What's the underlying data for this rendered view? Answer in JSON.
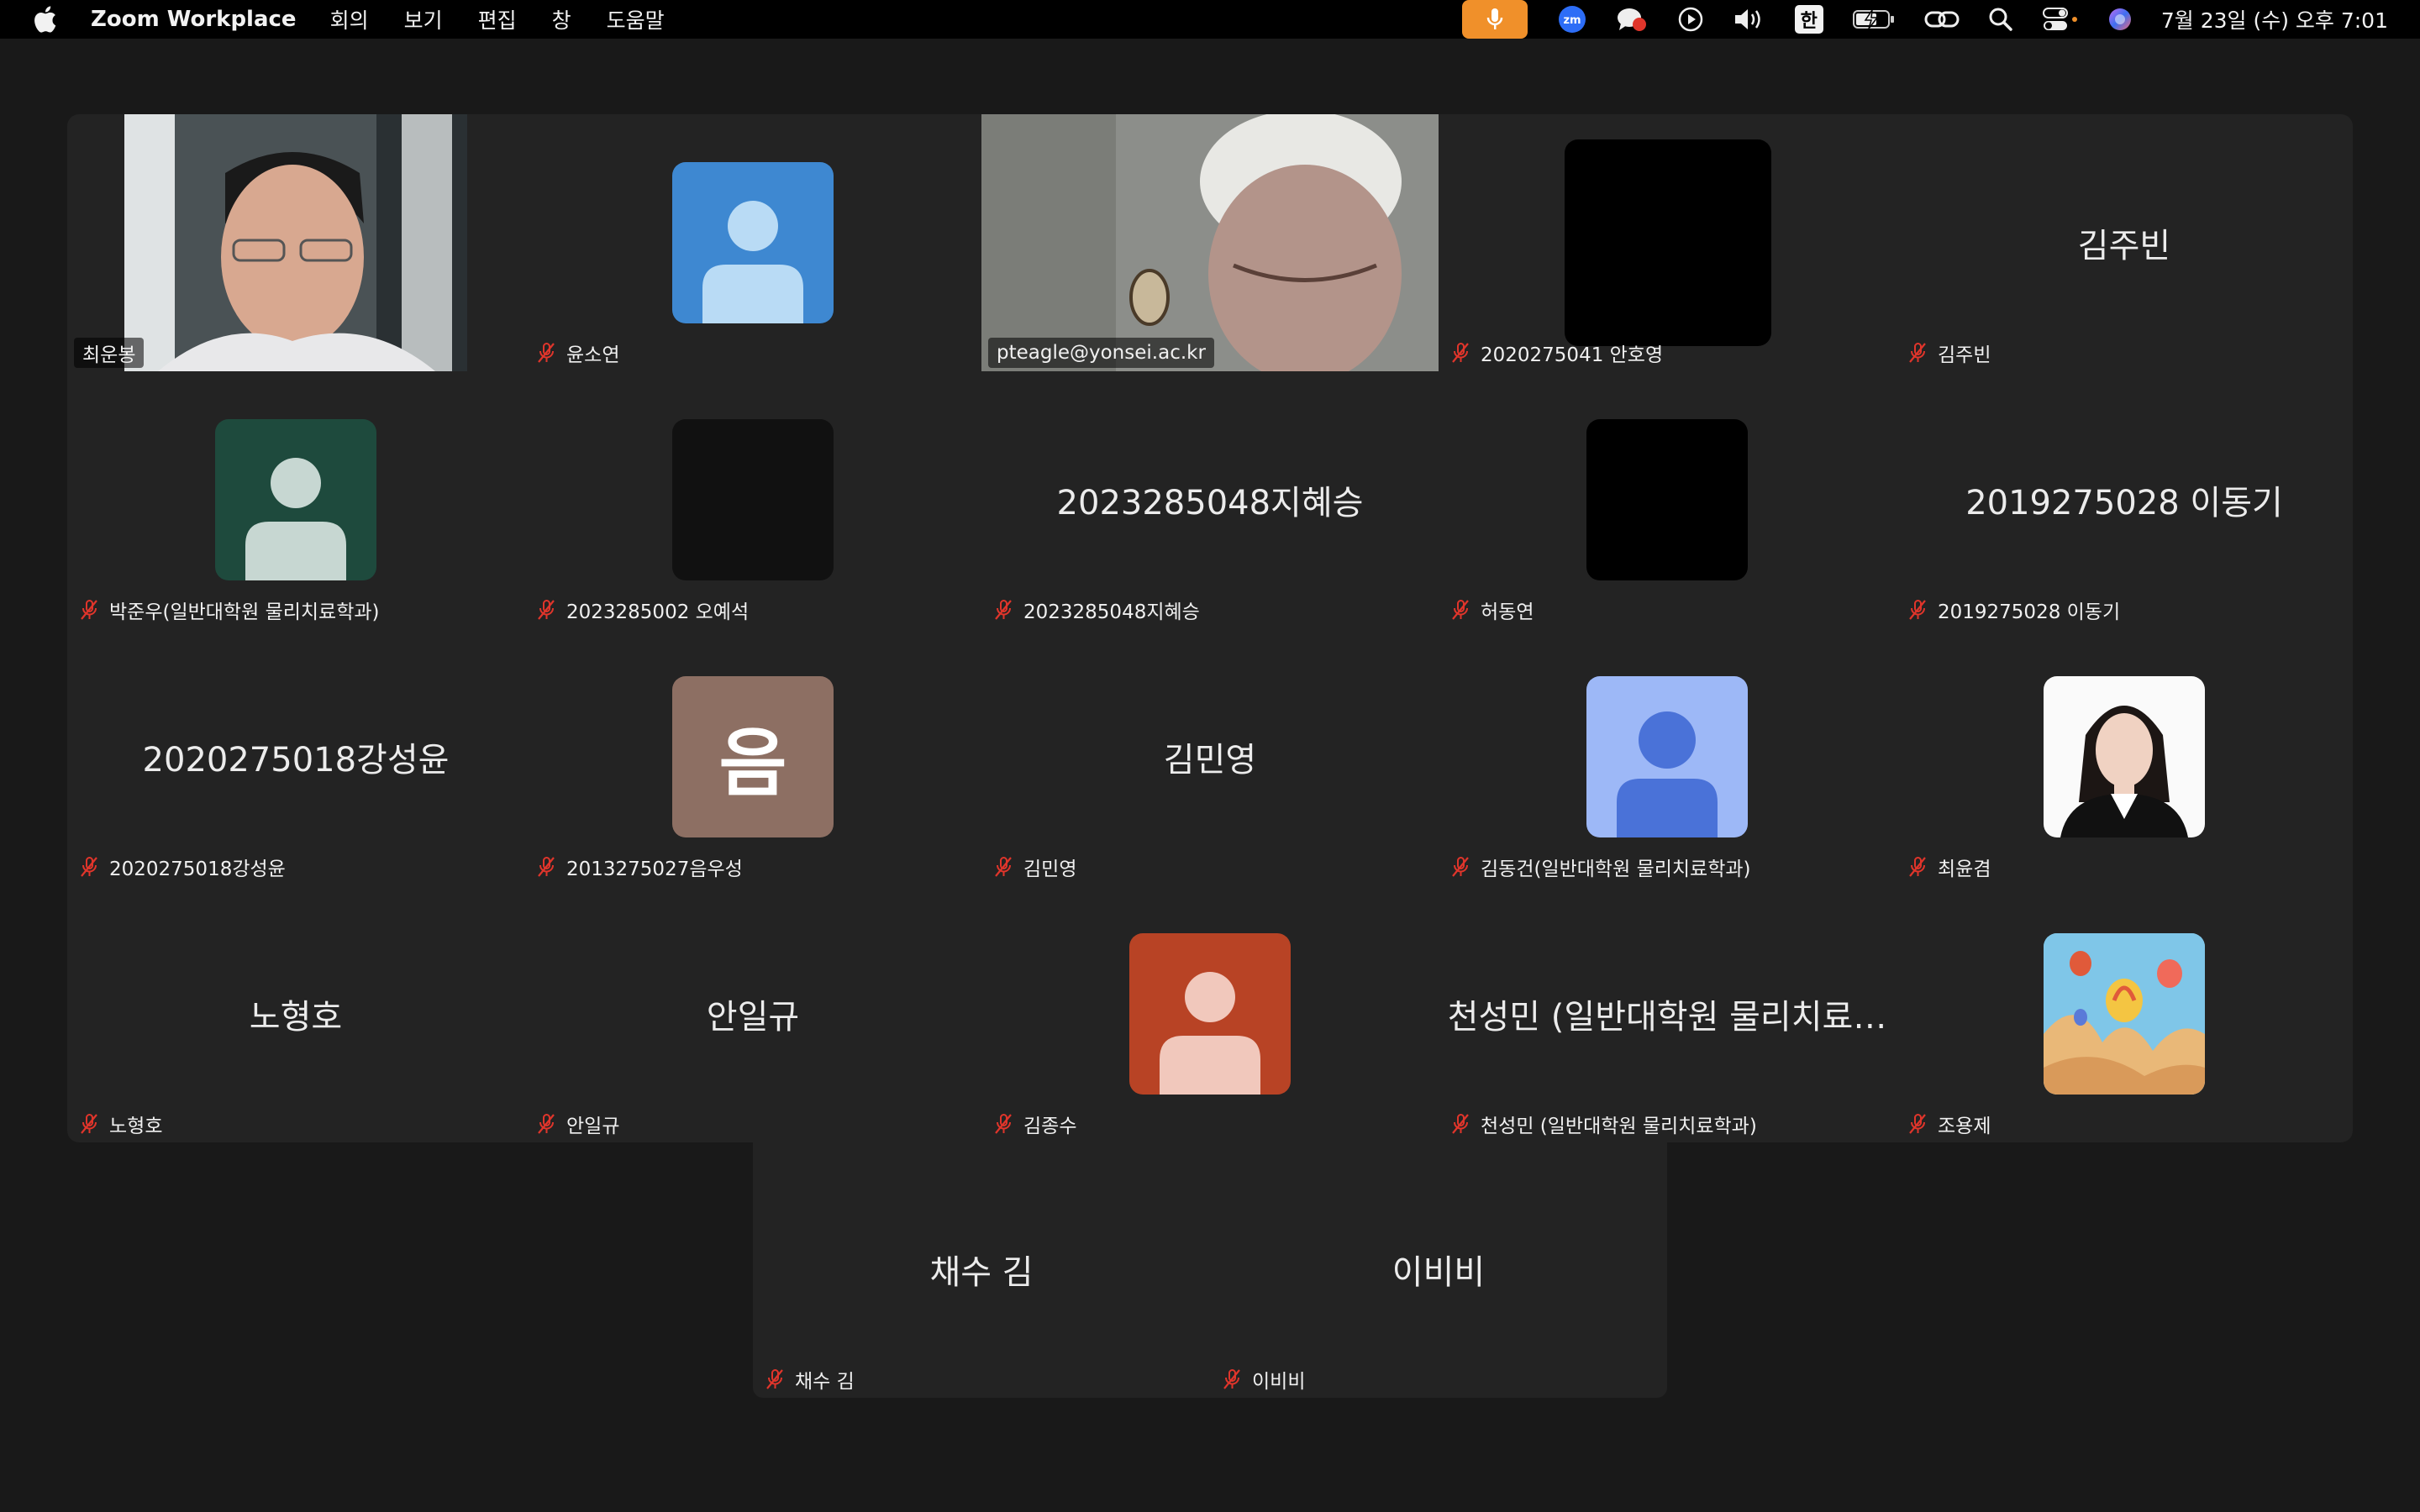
{
  "menubar": {
    "app_name": "Zoom Workplace",
    "menus": [
      "회의",
      "보기",
      "편집",
      "창",
      "도움말"
    ],
    "input_source": "한",
    "clock": "7월 23일 (수) 오후 7:01"
  },
  "colors": {
    "active_speaker": "#5bd464",
    "muted_icon": "#e0352b",
    "mic_indicator": "#f0902a"
  },
  "participants": [
    {
      "name": "최운봉",
      "display": "video",
      "muted": false
    },
    {
      "name": "윤소연",
      "display": "avatar-person",
      "avatar_bg": "#3e88d1",
      "muted": true
    },
    {
      "name": "pteagle@yonsei.ac.kr",
      "display": "video",
      "muted": false,
      "active": true
    },
    {
      "name": "2020275041 안호영",
      "display": "avatar-black",
      "muted": true
    },
    {
      "name": "김주빈",
      "center_text": "김주빈",
      "display": "name",
      "muted": true
    },
    {
      "name": "박준우(일반대학원 물리치료학과)",
      "display": "avatar-person",
      "avatar_bg": "#1e4a3d",
      "muted": true
    },
    {
      "name": "2023285002 오예석",
      "display": "avatar-dark",
      "muted": true
    },
    {
      "name": "2023285048지혜승",
      "center_text": "2023285048지혜승",
      "display": "name",
      "muted": true
    },
    {
      "name": "허동연",
      "display": "avatar-black",
      "muted": true
    },
    {
      "name": "2019275028 이동기",
      "center_text": "2019275028 이동기",
      "display": "name",
      "muted": true
    },
    {
      "name": "2020275018강성윤",
      "center_text": "2020275018강성윤",
      "display": "name",
      "muted": true
    },
    {
      "name": "2013275027음우성",
      "display": "avatar-letter",
      "avatar_letter": "음",
      "avatar_bg": "#8d6f63",
      "muted": true
    },
    {
      "name": "김민영",
      "center_text": "김민영",
      "display": "name",
      "muted": true
    },
    {
      "name": "김동건(일반대학원 물리치료학과)",
      "display": "avatar-person",
      "avatar_bg": "#9db8f7",
      "muted": true
    },
    {
      "name": "최윤겸",
      "display": "avatar-photo",
      "muted": true
    },
    {
      "name": "노형호",
      "center_text": "노형호",
      "display": "name",
      "muted": true
    },
    {
      "name": "안일규",
      "center_text": "안일규",
      "display": "name",
      "muted": true
    },
    {
      "name": "김종수",
      "display": "avatar-person",
      "avatar_bg": "#b84325",
      "muted": true
    },
    {
      "name": "천성민 (일반대학원 물리치료학과)",
      "center_text": "천성민 (일반대학원 물리치료…",
      "display": "name",
      "muted": true
    },
    {
      "name": "조용제",
      "display": "avatar-balloons",
      "muted": true
    },
    {
      "name": "채수 김",
      "center_text": "채수 김",
      "display": "name",
      "muted": true
    },
    {
      "name": "이비비",
      "center_text": "이비비",
      "display": "name",
      "muted": true
    }
  ]
}
